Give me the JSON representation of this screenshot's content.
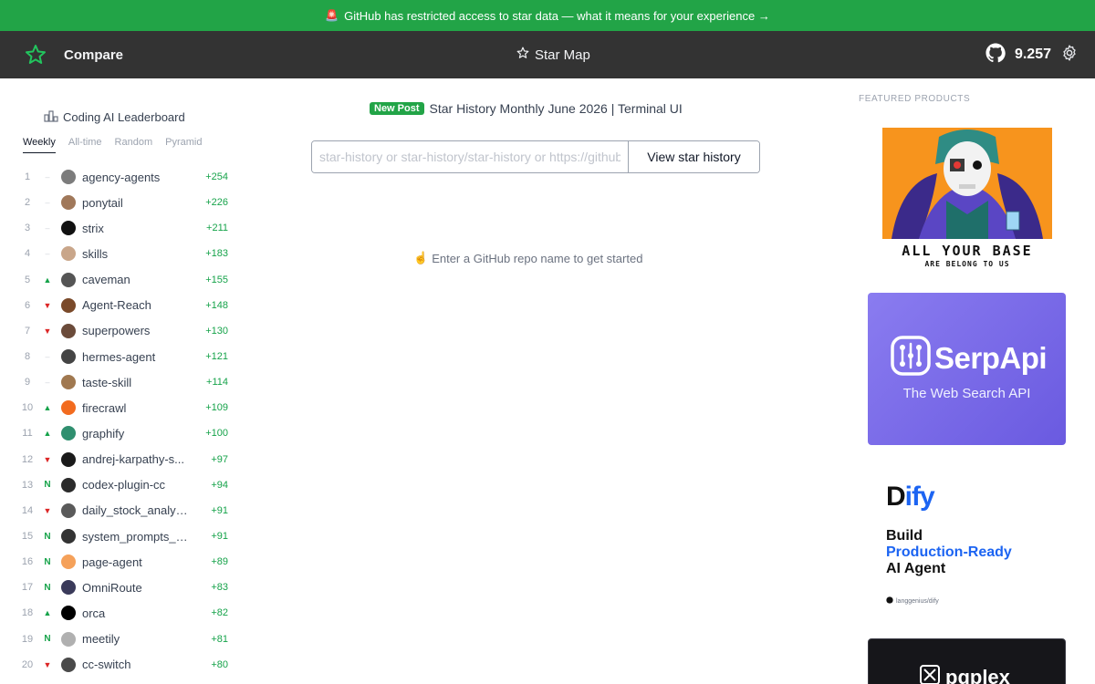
{
  "banner": {
    "text": "GitHub has restricted access to star data — what it means for your experience →",
    "color": "#22a447"
  },
  "nav": {
    "compare_label": "Compare",
    "starmap_label": "Star Map",
    "github_count": "9.257",
    "icons": [
      "star-history-logo-icon",
      "star-outline-icon",
      "github-icon",
      "gear-icon"
    ]
  },
  "leaderboard": {
    "title": "Coding AI Leaderboard",
    "tabs": [
      "Weekly",
      "All-time",
      "Random",
      "Pyramid"
    ],
    "active_tab": "Weekly",
    "rows": [
      {
        "rank": "1",
        "trend": "–",
        "name": "agency-agents",
        "delta": "+254"
      },
      {
        "rank": "2",
        "trend": "–",
        "name": "ponytail",
        "delta": "+226"
      },
      {
        "rank": "3",
        "trend": "–",
        "name": "strix",
        "delta": "+211"
      },
      {
        "rank": "4",
        "trend": "–",
        "name": "skills",
        "delta": "+183"
      },
      {
        "rank": "5",
        "trend": "▲",
        "name": "caveman",
        "delta": "+155"
      },
      {
        "rank": "6",
        "trend": "▼",
        "name": "Agent-Reach",
        "delta": "+148"
      },
      {
        "rank": "7",
        "trend": "▼",
        "name": "superpowers",
        "delta": "+130"
      },
      {
        "rank": "8",
        "trend": "–",
        "name": "hermes-agent",
        "delta": "+121"
      },
      {
        "rank": "9",
        "trend": "–",
        "name": "taste-skill",
        "delta": "+114"
      },
      {
        "rank": "10",
        "trend": "▲",
        "name": "firecrawl",
        "delta": "+109"
      },
      {
        "rank": "11",
        "trend": "▲",
        "name": "graphify",
        "delta": "+100"
      },
      {
        "rank": "12",
        "trend": "▼",
        "name": "andrej-karpathy-s...",
        "delta": "+97"
      },
      {
        "rank": "13",
        "trend": "N",
        "name": "codex-plugin-cc",
        "delta": "+94"
      },
      {
        "rank": "14",
        "trend": "▼",
        "name": "daily_stock_analysis",
        "delta": "+91"
      },
      {
        "rank": "15",
        "trend": "N",
        "name": "system_prompts_l...",
        "delta": "+91"
      },
      {
        "rank": "16",
        "trend": "N",
        "name": "page-agent",
        "delta": "+89"
      },
      {
        "rank": "17",
        "trend": "N",
        "name": "OmniRoute",
        "delta": "+83"
      },
      {
        "rank": "18",
        "trend": "▲",
        "name": "orca",
        "delta": "+82"
      },
      {
        "rank": "19",
        "trend": "N",
        "name": "meetily",
        "delta": "+81"
      },
      {
        "rank": "20",
        "trend": "▼",
        "name": "cc-switch",
        "delta": "+80"
      }
    ]
  },
  "center": {
    "new_post_badge": "New Post",
    "new_post_title": "Star History Monthly June 2026 | Terminal UI",
    "search_placeholder": "star-history or star-history/star-history or https://github.com/star-history/star-history",
    "search_value": "",
    "search_button": "View star history",
    "hint": "Enter a GitHub repo name to get started"
  },
  "featured": {
    "title": "FEATURED PRODUCTS",
    "ads": {
      "ayb_line1": "ALL YOUR BASE",
      "ayb_line2": "ARE BELONG TO US",
      "serp_name": "SerpApi",
      "serp_sub": "The Web Search API",
      "dify_logo_pre": "D",
      "dify_logo_mid": "ify",
      "dify_line1": "Build",
      "dify_line2": "Production-Ready",
      "dify_line3": "AI Agent",
      "dify_foot": "langgenius/dify",
      "pq_name": "pqplex"
    }
  },
  "colors": {
    "accent_green": "#22a447",
    "nav_bg": "#333333",
    "up": "#16a34a",
    "down": "#dc2626",
    "serp": "#7b6cf0",
    "dify_blue": "#1c64f2"
  }
}
